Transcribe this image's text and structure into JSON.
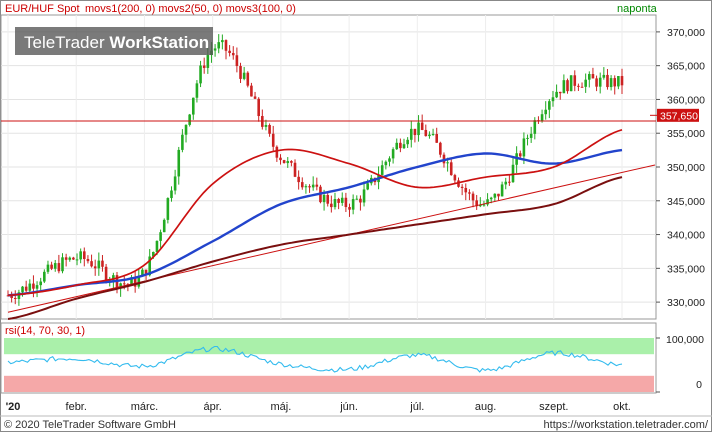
{
  "header": {
    "symbol": "EUR/HUF Spot",
    "indicators": "movs1(200, 0) movs2(50, 0) movs3(100, 0)",
    "period": "naponta"
  },
  "watermark": {
    "light": "TeleTrader ",
    "bold": "WorkStation"
  },
  "price_axis": {
    "ticks": [
      "370,000",
      "365,000",
      "360,000",
      "355,000",
      "350,000",
      "345,000",
      "340,000",
      "335,000",
      "330,000"
    ]
  },
  "last_price": "357,650",
  "rsi": {
    "label": "rsi(14, 70, 30, 1)",
    "ticks": [
      "100,000",
      "0"
    ]
  },
  "x_axis": {
    "labels": [
      "'20",
      "febr.",
      "márc.",
      "ápr.",
      "máj.",
      "jún.",
      "júl.",
      "aug.",
      "szept.",
      "okt."
    ]
  },
  "footer": {
    "copyright": "© 2020 TeleTrader Software GmbH",
    "url": "https://workstation.teletrader.com/"
  },
  "colors": {
    "candle_up": "#22aa22",
    "candle_down": "#cc2222",
    "movs1": "#7a0f0f",
    "movs2": "#cc1111",
    "movs3": "#2244cc",
    "hline": "#cc1111",
    "trendline": "#cc1111",
    "rsi_line": "#33bbee",
    "overbought_band": "#aaf0aa",
    "oversold_band": "#f5a8a8",
    "last_price_badge": "#cc1111",
    "symbol_text": "#cc0000",
    "period_text": "#008800"
  },
  "chart_data": {
    "type": "line",
    "title": "EUR/HUF Spot",
    "xlabel": "",
    "ylabel": "",
    "ylim": [
      327.5,
      372.5
    ],
    "x": [
      "'20",
      "febr.",
      "márc.",
      "ápr.",
      "máj.",
      "jún.",
      "júl.",
      "aug.",
      "szept.",
      "okt."
    ],
    "series": [
      {
        "name": "EUR/HUF Spot",
        "values": [
          331.0,
          336.5,
          334.5,
          367.5,
          351.5,
          344.5,
          355.5,
          344.5,
          361.0,
          362.5
        ]
      },
      {
        "name": "movs1(200, 0)",
        "values": [
          327.5,
          330.5,
          333.0,
          336.0,
          338.5,
          340.0,
          341.5,
          343.0,
          344.5,
          348.5
        ]
      },
      {
        "name": "movs2(50, 0)",
        "values": [
          331.0,
          332.5,
          335.5,
          347.5,
          352.5,
          350.5,
          347.0,
          348.5,
          350.0,
          355.5
        ]
      },
      {
        "name": "movs3(100, 0)",
        "values": [
          331.0,
          332.5,
          334.0,
          339.0,
          344.5,
          347.0,
          350.0,
          352.0,
          350.5,
          352.5
        ]
      }
    ],
    "hline": 356.8,
    "last": 357.65,
    "rsi": {
      "name": "rsi(14, 70, 30, 1)",
      "ylim": [
        0,
        100
      ],
      "bands": {
        "overbought": 70,
        "oversold": 30
      },
      "values": [
        55,
        62,
        48,
        80,
        52,
        42,
        68,
        40,
        72,
        50
      ]
    }
  }
}
